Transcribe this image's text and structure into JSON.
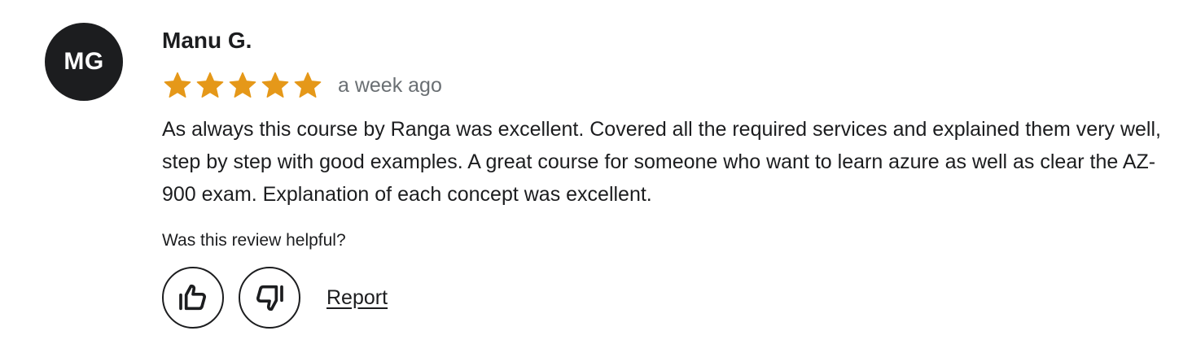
{
  "review": {
    "avatar_initials": "MG",
    "reviewer_name": "Manu G.",
    "rating": 5,
    "rating_max": 5,
    "star_color": "#e59819",
    "date": "a week ago",
    "text": "As always this course by Ranga was excellent. Covered all the required services and explained them very well, step by step with good examples. A great course for someone who want to learn azure as well as clear the AZ-900 exam. Explanation of each concept was excellent.",
    "helpful_prompt": "Was this review helpful?",
    "thumbs_up_icon": "thumbs-up-icon",
    "thumbs_down_icon": "thumbs-down-icon",
    "report_label": "Report"
  }
}
